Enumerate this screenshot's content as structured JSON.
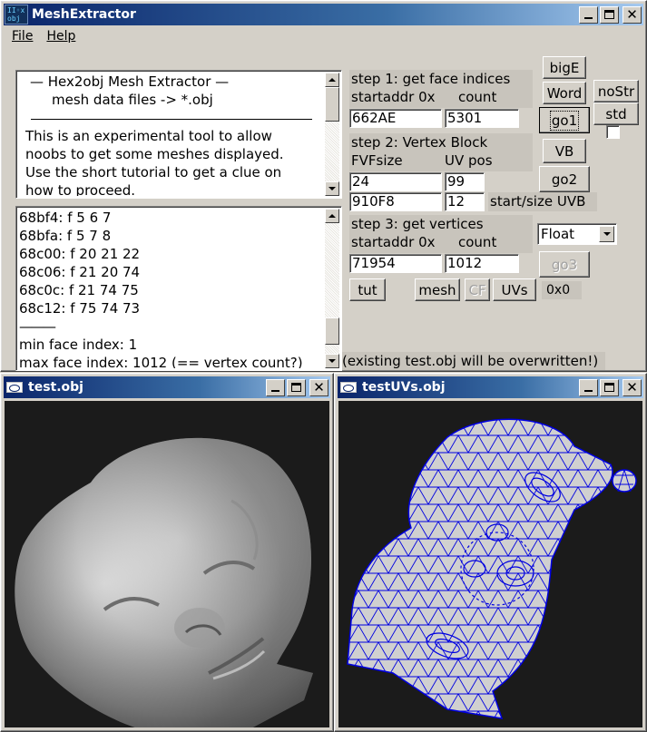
{
  "main_window": {
    "title": "MeshExtractor",
    "icon_text_line1": "II◦x",
    "icon_text_line2": "obj"
  },
  "menu": {
    "file": "File",
    "help": "Help"
  },
  "info_text": {
    "heading1": "— Hex2obj Mesh Extractor —",
    "heading2": "mesh data files -> *.obj",
    "paragraph": [
      "This is an experimental tool to allow",
      "noobs to get some meshes displayed.",
      "Use the short tutorial to get a clue on",
      "how to proceed."
    ]
  },
  "log_text": {
    "lines": [
      "68bf4: f  5 6 7",
      "68bfa: f  5 7 8",
      "68c00: f  20 21 22",
      "68c06: f  21 20 74",
      "68c0c: f  21 74 75",
      "68c12: f  75 74 73"
    ],
    "separator": "———",
    "summary": [
      "min face index: 1",
      "max face index: 1012 (== vertex count?)"
    ]
  },
  "step1": {
    "title": "step 1: get face indices",
    "startaddr_label": "startaddr 0x",
    "count_label": "count",
    "startaddr_value": "662AE",
    "count_value": "5301"
  },
  "step2": {
    "title": "step 2: Vertex Block",
    "fvfsize_label": "FVFsize",
    "uvpos_label": "UV pos",
    "fvfsize_value": "24",
    "uvpos_value": "99",
    "uvb_start_value": "910F8",
    "uvb_size_value": "12",
    "uvb_label": "start/size UVB"
  },
  "step3": {
    "title": "step 3: get vertices",
    "startaddr_label": "startaddr 0x",
    "count_label": "count",
    "startaddr_value": "71954",
    "count_value": "1012"
  },
  "buttons": {
    "bigE": "bigE",
    "word": "Word",
    "noStr": "noStr",
    "std": "std",
    "go1": "go1",
    "vb": "VB",
    "go2": "go2",
    "go3": "go3",
    "tut": "tut",
    "mesh": "mesh",
    "cf": "CF",
    "uvs": "UVs"
  },
  "format_select": {
    "selected": "Float"
  },
  "hex_value": "0x0",
  "overwrite_note": "(existing test.obj will be overwritten!)",
  "child_windows": {
    "mesh_view_title": "test.obj",
    "uv_view_title": "testUVs.obj"
  },
  "colors": {
    "titlebar_start": "#0a246a",
    "titlebar_end": "#a6caf0",
    "viewport_bg": "#1b1b1b",
    "uv_wire": "#0000e0"
  }
}
